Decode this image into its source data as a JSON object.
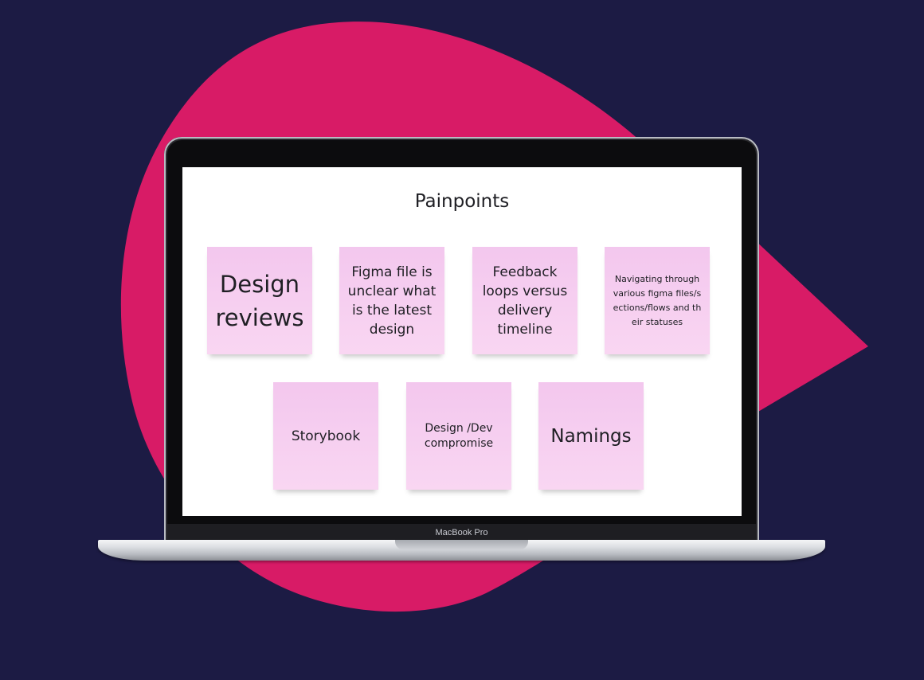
{
  "colors": {
    "background": "#1c1b44",
    "blob": "#d81b66",
    "sticky_note": "#f6cdf0",
    "screen": "#ffffff"
  },
  "device": {
    "label": "MacBook Pro"
  },
  "board": {
    "title": "Painpoints",
    "sticky_notes": [
      {
        "text": "Design reviews"
      },
      {
        "text": "Figma file is unclear what is the latest design"
      },
      {
        "text": "Feedback loops versus delivery timeline"
      },
      {
        "text": "Navigating through various figma files/sections/flows and their statuses"
      },
      {
        "text": "Storybook"
      },
      {
        "text": "Design /Dev compromise"
      },
      {
        "text": "Namings"
      }
    ]
  }
}
